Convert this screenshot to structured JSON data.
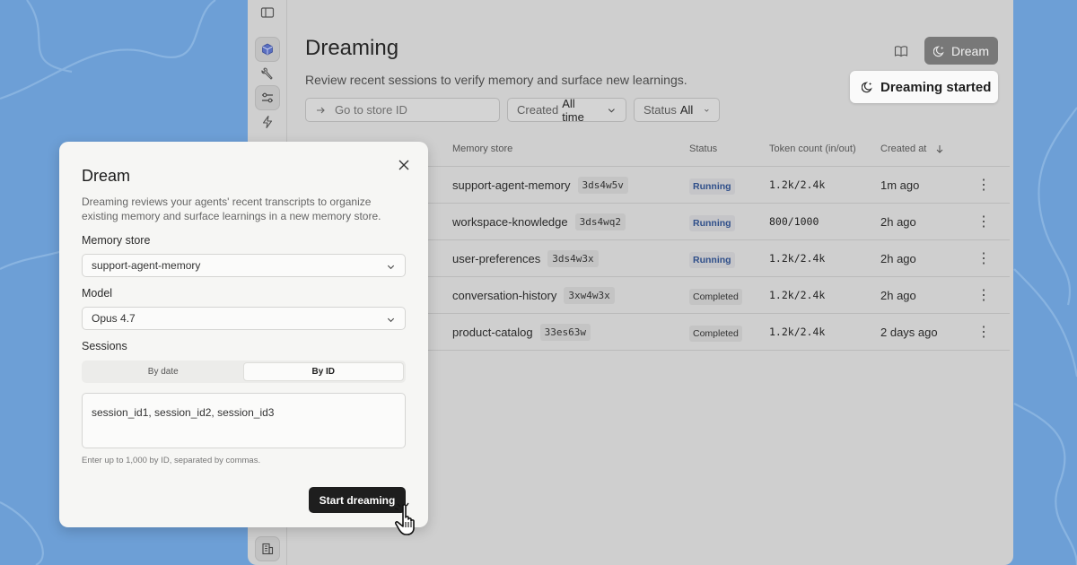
{
  "page": {
    "title": "Dreaming",
    "subtitle": "Review recent sessions to verify memory and surface new learnings.",
    "dream_button": "Dream",
    "toast": "Dreaming started"
  },
  "filters": {
    "search_placeholder": "Go to store ID",
    "created_label": "Created",
    "created_value": "All time",
    "status_label": "Status",
    "status_value": "All"
  },
  "table": {
    "headers": {
      "memory_store": "Memory store",
      "status": "Status",
      "token_count": "Token count (in/out)",
      "created_at": "Created at"
    },
    "rows": [
      {
        "store": "support-agent-memory",
        "id": "3ds4w5v",
        "status": "Running",
        "tokens": "1.2k/2.4k",
        "created": "1m ago"
      },
      {
        "store": "workspace-knowledge",
        "id": "3ds4wq2",
        "status": "Running",
        "tokens": "800/1000",
        "created": "2h ago"
      },
      {
        "store": "user-preferences",
        "id": "3ds4w3x",
        "status": "Running",
        "tokens": "1.2k/2.4k",
        "created": "2h ago"
      },
      {
        "store": "conversation-history",
        "id": "3xw4w3x",
        "status": "Completed",
        "tokens": "1.2k/2.4k",
        "created": "2h ago"
      },
      {
        "store": "product-catalog",
        "id": "33es63w",
        "status": "Completed",
        "tokens": "1.2k/2.4k",
        "created": "2 days ago"
      }
    ]
  },
  "modal": {
    "title": "Dream",
    "description": "Dreaming reviews your agents' recent transcripts to organize existing memory and surface learnings in a new memory store.",
    "memory_store_label": "Memory store",
    "memory_store_value": "support-agent-memory",
    "model_label": "Model",
    "model_value": "Opus 4.7",
    "sessions_label": "Sessions",
    "seg_by_date": "By date",
    "seg_by_id": "By ID",
    "sessions_value": "session_id1, session_id2, session_id3",
    "help_text": "Enter up to 1,000 by ID, separated by commas.",
    "submit": "Start dreaming"
  },
  "colors": {
    "background": "#6d9fd6",
    "app_bg": "#cfcfcf",
    "running": "#2f4f8a",
    "submit": "#1e1e1e"
  },
  "icons": [
    "sidebar-toggle-icon",
    "cube-icon",
    "wrench-icon",
    "sliders-icon",
    "bolt-icon",
    "building-icon",
    "book-icon",
    "moon-sparkle-icon",
    "arrow-right-icon",
    "chevron-down-icon",
    "sort-arrow-icon",
    "more-vertical-icon",
    "close-icon",
    "hand-cursor-icon"
  ]
}
